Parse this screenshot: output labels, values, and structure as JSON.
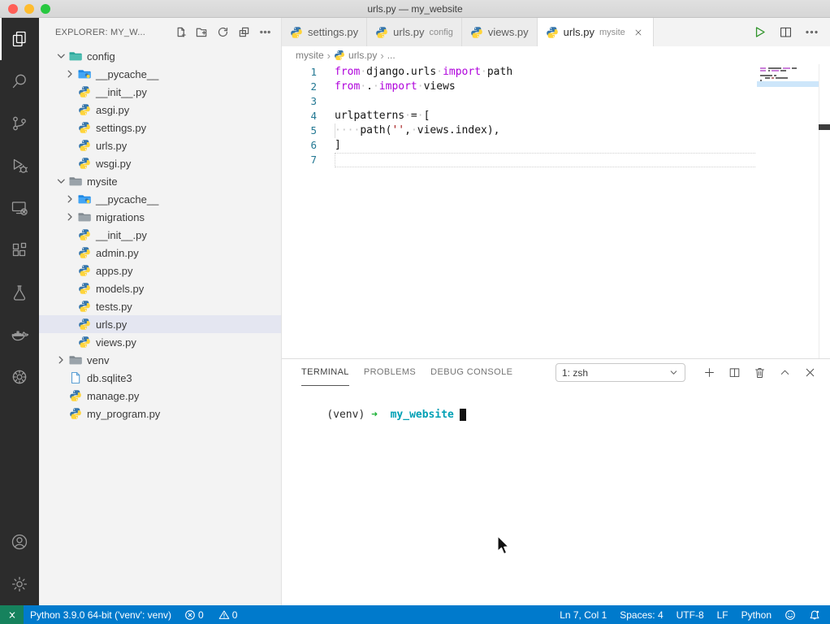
{
  "window": {
    "title": "urls.py — my_website"
  },
  "activity_bar": {
    "top_items": [
      {
        "name": "explorer",
        "icon": "files",
        "active": true
      },
      {
        "name": "search",
        "icon": "search",
        "active": false
      },
      {
        "name": "source-control",
        "icon": "source-control",
        "active": false
      },
      {
        "name": "run-debug",
        "icon": "debug",
        "active": false
      },
      {
        "name": "remote-explorer",
        "icon": "remote",
        "active": false
      },
      {
        "name": "extensions",
        "icon": "extensions",
        "active": false
      },
      {
        "name": "testing",
        "icon": "beaker",
        "active": false
      },
      {
        "name": "docker",
        "icon": "docker",
        "active": false
      },
      {
        "name": "extension-gear",
        "icon": "gear-circle",
        "active": false
      }
    ],
    "bottom_items": [
      {
        "name": "accounts",
        "icon": "account"
      },
      {
        "name": "manage",
        "icon": "settings"
      }
    ]
  },
  "explorer": {
    "title": "EXPLORER: MY_W...",
    "actions": [
      {
        "name": "new-file",
        "icon": "new-file"
      },
      {
        "name": "new-folder",
        "icon": "new-folder"
      },
      {
        "name": "refresh-explorer",
        "icon": "refresh"
      },
      {
        "name": "collapse-folders",
        "icon": "collapse"
      },
      {
        "name": "more-actions",
        "icon": "ellipsis"
      }
    ],
    "tree": [
      {
        "label": "config",
        "level": 0,
        "chevron": "down",
        "icon": "folder-config"
      },
      {
        "label": "__pycache__",
        "level": 1,
        "chevron": "right",
        "icon": "folder-pycache"
      },
      {
        "label": "__init__.py",
        "level": 1,
        "chevron": null,
        "icon": "python"
      },
      {
        "label": "asgi.py",
        "level": 1,
        "chevron": null,
        "icon": "python"
      },
      {
        "label": "settings.py",
        "level": 1,
        "chevron": null,
        "icon": "python"
      },
      {
        "label": "urls.py",
        "level": 1,
        "chevron": null,
        "icon": "python"
      },
      {
        "label": "wsgi.py",
        "level": 1,
        "chevron": null,
        "icon": "python"
      },
      {
        "label": "mysite",
        "level": 0,
        "chevron": "down",
        "icon": "folder-gray"
      },
      {
        "label": "__pycache__",
        "level": 1,
        "chevron": "right",
        "icon": "folder-pycache"
      },
      {
        "label": "migrations",
        "level": 1,
        "chevron": "right",
        "icon": "folder-gray"
      },
      {
        "label": "__init__.py",
        "level": 1,
        "chevron": null,
        "icon": "python"
      },
      {
        "label": "admin.py",
        "level": 1,
        "chevron": null,
        "icon": "python"
      },
      {
        "label": "apps.py",
        "level": 1,
        "chevron": null,
        "icon": "python"
      },
      {
        "label": "models.py",
        "level": 1,
        "chevron": null,
        "icon": "python"
      },
      {
        "label": "tests.py",
        "level": 1,
        "chevron": null,
        "icon": "python"
      },
      {
        "label": "urls.py",
        "level": 1,
        "chevron": null,
        "icon": "python",
        "selected": true
      },
      {
        "label": "views.py",
        "level": 1,
        "chevron": null,
        "icon": "python"
      },
      {
        "label": "venv",
        "level": 0,
        "chevron": "right",
        "icon": "folder-gray"
      },
      {
        "label": "db.sqlite3",
        "level": 0,
        "chevron": null,
        "icon": "sqlite"
      },
      {
        "label": "manage.py",
        "level": 0,
        "chevron": null,
        "icon": "python"
      },
      {
        "label": "my_program.py",
        "level": 0,
        "chevron": null,
        "icon": "python"
      }
    ]
  },
  "editor_tabs": {
    "items": [
      {
        "label": "settings.py",
        "description": "",
        "icon": "python",
        "active": false,
        "close": false
      },
      {
        "label": "urls.py",
        "description": "config",
        "icon": "python",
        "active": false,
        "close": false
      },
      {
        "label": "views.py",
        "description": "",
        "icon": "python",
        "active": false,
        "close": false
      },
      {
        "label": "urls.py",
        "description": "mysite",
        "icon": "python",
        "active": true,
        "close": true
      }
    ],
    "actions": [
      {
        "name": "run-python-file",
        "icon": "play"
      },
      {
        "name": "split-editor",
        "icon": "split"
      },
      {
        "name": "more-editor-actions",
        "icon": "ellipsis24"
      }
    ]
  },
  "breadcrumb": {
    "items": [
      {
        "label": "mysite",
        "icon": null
      },
      {
        "label": "urls.py",
        "icon": "python"
      },
      {
        "label": "...",
        "icon": null
      }
    ]
  },
  "editor": {
    "lines": [
      {
        "num": "1",
        "tokens": [
          [
            "from",
            "kw"
          ],
          [
            "·",
            "ws"
          ],
          [
            "django.urls",
            "pl"
          ],
          [
            "·",
            "ws"
          ],
          [
            "import",
            "kw"
          ],
          [
            "·",
            "ws"
          ],
          [
            "path",
            "pl"
          ]
        ]
      },
      {
        "num": "2",
        "tokens": [
          [
            "from",
            "kw"
          ],
          [
            "·",
            "ws"
          ],
          [
            ".",
            "pl"
          ],
          [
            "·",
            "ws"
          ],
          [
            "import",
            "kw"
          ],
          [
            "·",
            "ws"
          ],
          [
            "views",
            "pl"
          ]
        ]
      },
      {
        "num": "3",
        "tokens": []
      },
      {
        "num": "4",
        "tokens": [
          [
            "urlpatterns",
            "pl"
          ],
          [
            "·",
            "ws"
          ],
          [
            "=",
            "pl"
          ],
          [
            "·",
            "ws"
          ],
          [
            "[",
            "pl"
          ]
        ]
      },
      {
        "num": "5",
        "tokens": [
          [
            "····",
            "ws"
          ],
          [
            "path(",
            "pl"
          ],
          [
            "''",
            "str"
          ],
          [
            ",",
            "pl"
          ],
          [
            "·",
            "ws"
          ],
          [
            "views.index),",
            "pl"
          ]
        ],
        "guide": true
      },
      {
        "num": "6",
        "tokens": [
          [
            "]",
            "pl"
          ]
        ]
      },
      {
        "num": "7",
        "tokens": [],
        "current": true
      }
    ]
  },
  "panel": {
    "tabs": [
      {
        "label": "TERMINAL",
        "active": true
      },
      {
        "label": "PROBLEMS",
        "active": false
      },
      {
        "label": "DEBUG CONSOLE",
        "active": false
      }
    ],
    "dropdown": {
      "value": "1: zsh"
    },
    "actions": [
      {
        "name": "new-terminal",
        "icon": "plus"
      },
      {
        "name": "split-terminal",
        "icon": "split"
      },
      {
        "name": "kill-terminal",
        "icon": "trash"
      },
      {
        "name": "maximize-panel",
        "icon": "chevron-up"
      },
      {
        "name": "close-panel",
        "icon": "close"
      }
    ],
    "terminal_line": [
      [
        "(venv) ",
        "t-plain"
      ],
      [
        "➜",
        "t-green"
      ],
      [
        "  ",
        "t-plain"
      ],
      [
        "my_website",
        "t-cyan"
      ]
    ]
  },
  "status_bar": {
    "left": [
      {
        "name": "remote-indicator",
        "icon": "remote-sign",
        "text": ""
      },
      {
        "name": "python-interpreter",
        "text": "Python 3.9.0 64-bit ('venv': venv)"
      },
      {
        "name": "problems",
        "parts": [
          {
            "icon": "error",
            "text": "0"
          },
          {
            "icon": "warning",
            "text": "0"
          }
        ]
      }
    ],
    "right": [
      {
        "name": "cursor-position",
        "text": "Ln 7, Col 1"
      },
      {
        "name": "indentation",
        "text": "Spaces: 4"
      },
      {
        "name": "encoding",
        "text": "UTF-8"
      },
      {
        "name": "eol-sequence",
        "text": "LF"
      },
      {
        "name": "language-mode",
        "text": "Python"
      },
      {
        "name": "feedback",
        "icon": "feedback",
        "text": ""
      },
      {
        "name": "notifications",
        "icon": "bell-dot",
        "text": ""
      }
    ]
  },
  "colors": {
    "accent": "#007acc",
    "remote_green": "#16825d",
    "keyword": "#af00db",
    "string": "#a31515",
    "line_number": "#237893",
    "terminal_green": "#1ab135",
    "terminal_cyan": "#00a0b5"
  }
}
